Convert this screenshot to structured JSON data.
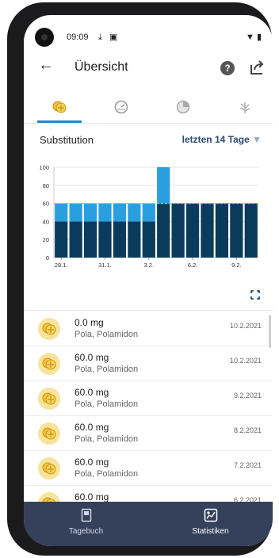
{
  "status_bar": {
    "time": "09:09"
  },
  "header": {
    "title": "Übersicht",
    "help_label": "?"
  },
  "tabs": [
    {
      "icon": "pill-icon",
      "active": true
    },
    {
      "icon": "gauge-icon",
      "active": false
    },
    {
      "icon": "pie-icon",
      "active": false
    },
    {
      "icon": "leaf-icon",
      "active": false
    }
  ],
  "section": {
    "title": "Substitution",
    "range": "letzten 14 Tage"
  },
  "chart_data": {
    "type": "bar",
    "stacked": true,
    "categories": [
      "28.1.",
      "29.1.",
      "30.1.",
      "31.1.",
      "1.2.",
      "2.2.",
      "3.2.",
      "4.2.",
      "5.2.",
      "6.2.",
      "7.2.",
      "8.2.",
      "9.2.",
      "10.2."
    ],
    "tick_labels": [
      "28.1.",
      "31.1.",
      "3.2.",
      "6.2.",
      "9.2."
    ],
    "series": [
      {
        "color": "#0b3b5c",
        "values": [
          40,
          40,
          40,
          40,
          40,
          40,
          40,
          60,
          60,
          60,
          60,
          60,
          60,
          60
        ]
      },
      {
        "color": "#2a9fdf",
        "values": [
          20,
          20,
          20,
          20,
          20,
          20,
          20,
          40,
          0,
          0,
          0,
          0,
          0,
          0
        ]
      }
    ],
    "reference_line": 60,
    "ylim": [
      0,
      100
    ],
    "yticks": [
      0,
      20,
      40,
      60,
      80,
      100
    ],
    "xlabel": "",
    "ylabel": ""
  },
  "entries": [
    {
      "dose": "0.0 mg",
      "substances": "Pola, Polamidon",
      "date": "10.2.2021"
    },
    {
      "dose": "60.0 mg",
      "substances": "Pola, Polamidon",
      "date": "10.2.2021"
    },
    {
      "dose": "60.0 mg",
      "substances": "Pola, Polamidon",
      "date": "9.2.2021"
    },
    {
      "dose": "60.0 mg",
      "substances": "Pola, Polamidon",
      "date": "8.2.2021"
    },
    {
      "dose": "60.0 mg",
      "substances": "Pola, Polamidon",
      "date": "7.2.2021"
    },
    {
      "dose": "60.0 mg",
      "substances": "",
      "date": "6.2.2021"
    }
  ],
  "bottom_nav": [
    {
      "label": "Tagebuch",
      "icon": "diary-icon",
      "active": false
    },
    {
      "label": "Statistiken",
      "icon": "statistics-icon",
      "active": true
    }
  ],
  "colors": {
    "accent": "#2386c8",
    "nav_bg": "#35405b",
    "bar_dark": "#0b3b5c",
    "bar_light": "#2a9fdf",
    "ref_line": "#d8c23b"
  }
}
